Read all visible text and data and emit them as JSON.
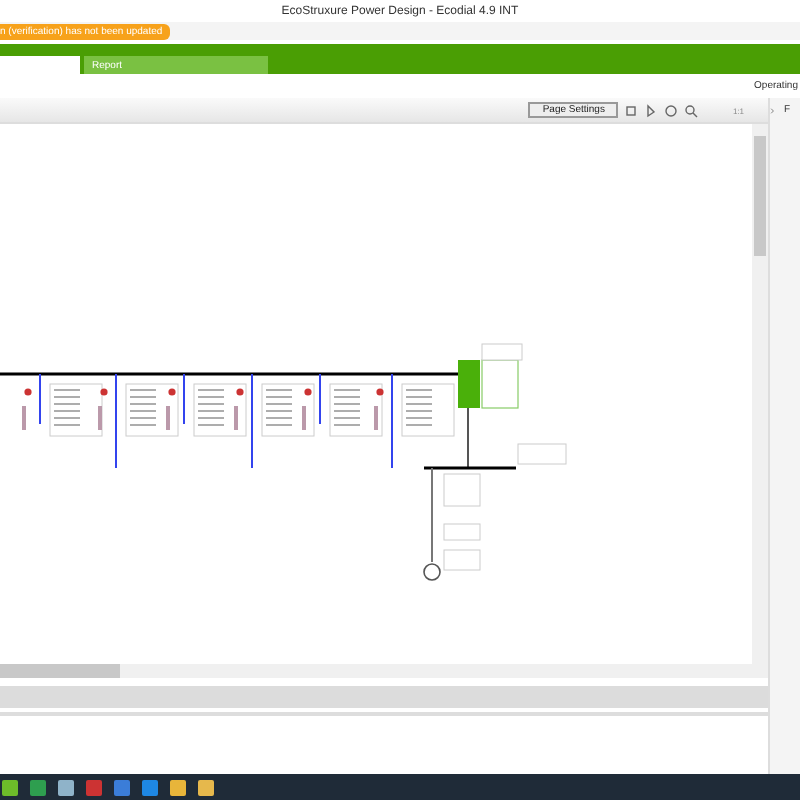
{
  "window": {
    "title": "EcoStruxure Power Design - Ecodial 4.9 INT"
  },
  "warning": {
    "text": "n (verification) has not been updated"
  },
  "tabs": [
    {
      "selected": true
    },
    {
      "label": "Report",
      "selected": false
    }
  ],
  "operating_label": "Operating",
  "toolbar": {
    "page_settings": "Page Settings",
    "zoom_ratio": "1:1"
  },
  "side_panel": {
    "label": "F"
  }
}
